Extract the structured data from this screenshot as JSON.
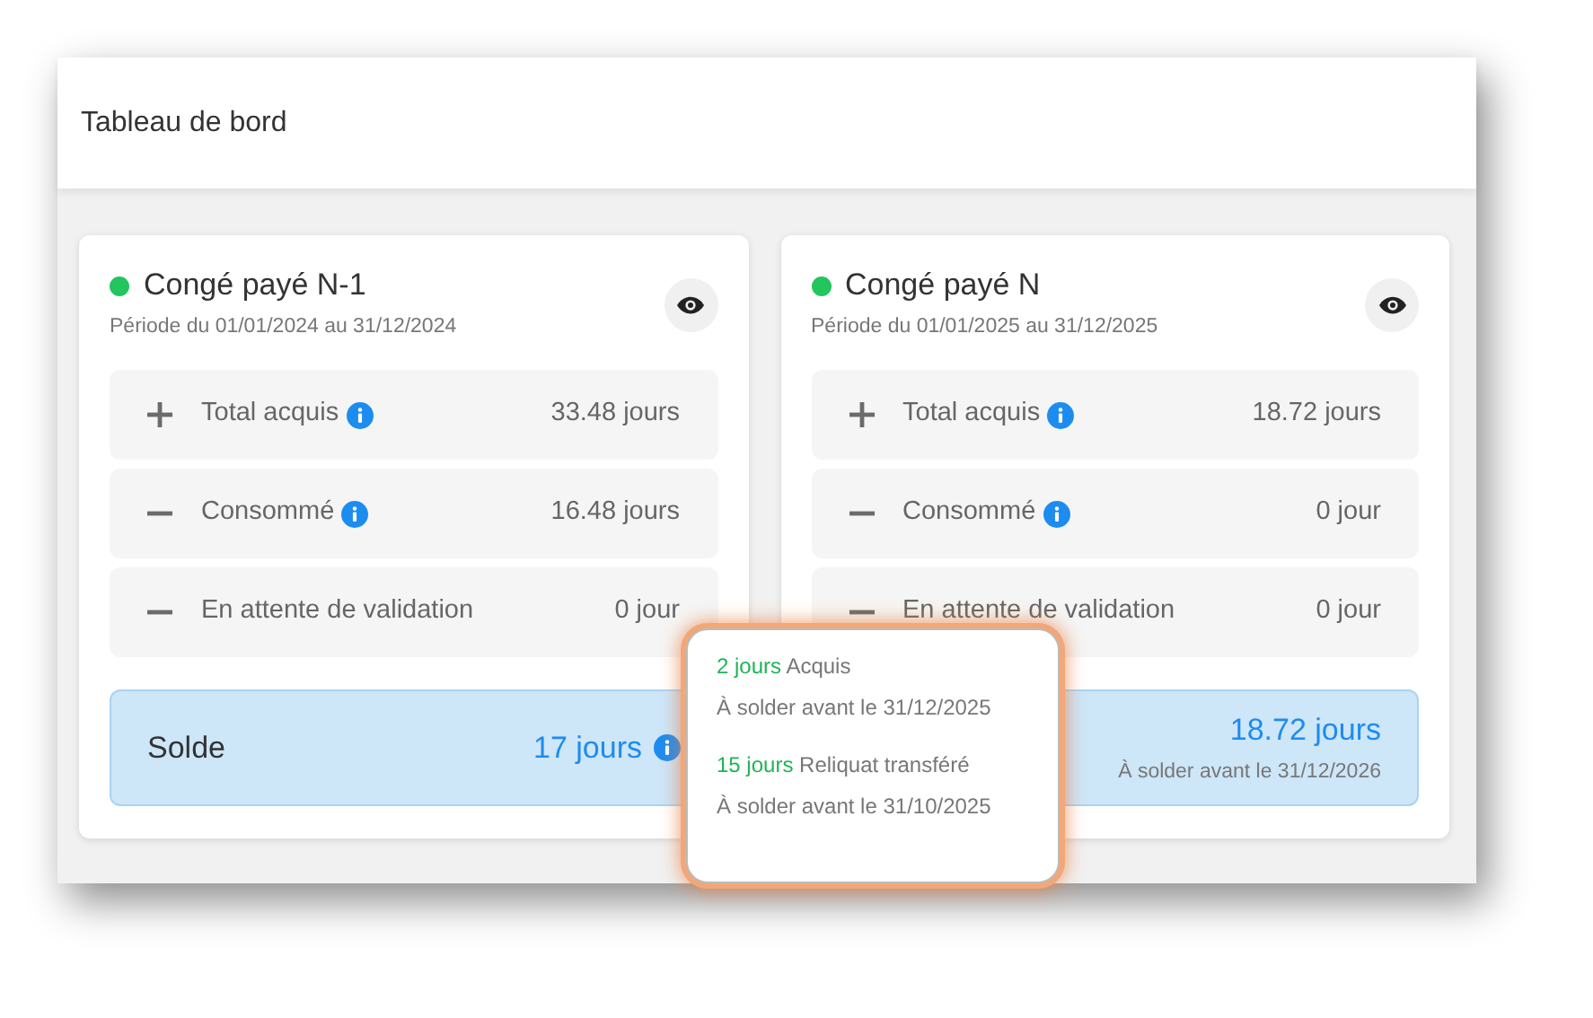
{
  "header": {
    "title": "Tableau de bord"
  },
  "cards": [
    {
      "title": "Congé payé N-1",
      "color": "#22c55e",
      "period": "Période du 01/01/2024 au 31/12/2024",
      "rows": [
        {
          "kind": "plus",
          "label": "Total acquis",
          "info": true,
          "value": "33.48 jours"
        },
        {
          "kind": "minus",
          "label": "Consommé",
          "info": true,
          "value": "16.48 jours"
        },
        {
          "kind": "minus",
          "label": "En attente de validation",
          "info": false,
          "value": "0 jour"
        }
      ],
      "balance": {
        "label": "Solde",
        "value": "17 jours",
        "info": true
      }
    },
    {
      "title": "Congé payé N",
      "color": "#22c55e",
      "period": "Période du 01/01/2025 au 31/12/2025",
      "rows": [
        {
          "kind": "plus",
          "label": "Total acquis",
          "info": true,
          "value": "18.72 jours"
        },
        {
          "kind": "minus",
          "label": "Consommé",
          "info": true,
          "value": "0 jour"
        },
        {
          "kind": "minus",
          "label": "En attente de validation",
          "info": false,
          "value": "0 jour"
        }
      ],
      "balance": {
        "value": "18.72 jours",
        "info": false,
        "note": "À solder avant le 31/12/2026"
      }
    }
  ],
  "tooltip": {
    "entries": [
      {
        "amount": "2 jours",
        "label": "Acquis",
        "note": "À solder avant le 31/12/2025"
      },
      {
        "amount": "15 jours",
        "label": "Reliquat transféré",
        "note": "À solder avant le 31/10/2025"
      }
    ]
  }
}
